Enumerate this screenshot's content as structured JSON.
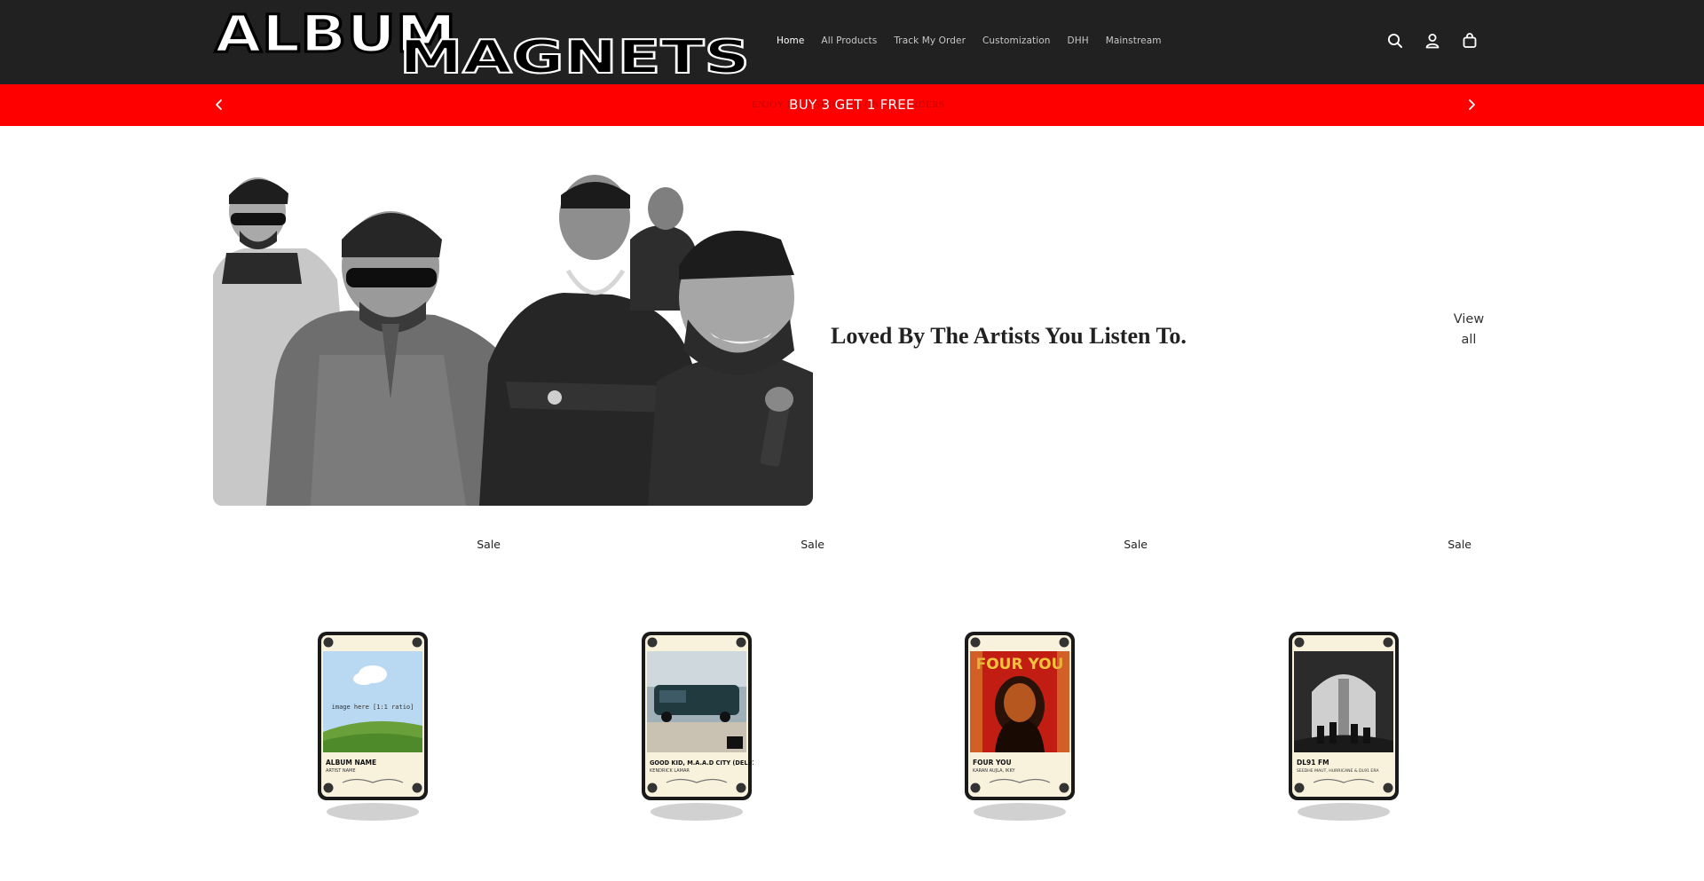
{
  "header": {
    "logo_text_top": "ALBUM",
    "logo_text_bottom": "MAGNETS",
    "nav": [
      {
        "label": "Home",
        "active": true
      },
      {
        "label": "All Products",
        "active": false
      },
      {
        "label": "Track My Order",
        "active": false
      },
      {
        "label": "Customization",
        "active": false
      },
      {
        "label": "DHH",
        "active": false
      },
      {
        "label": "Mainstream",
        "active": false
      }
    ],
    "icons": [
      "search-icon",
      "account-icon",
      "cart-icon"
    ]
  },
  "announcement": {
    "text": "BUY 3 GET 1 FREE",
    "ghost_text": "ENJOY FREE SHIPPING ON ALL ORDERS",
    "background": "#fe0000",
    "icons": [
      "chevron-left-icon",
      "chevron-right-icon"
    ]
  },
  "hero": {
    "title": "Loved By The Artists You Listen To.",
    "view_all_line1": "View",
    "view_all_line2": "all"
  },
  "products": [
    {
      "badge": "Sale",
      "card_title": "ALBUM NAME",
      "card_artist": "ARTIST NAME",
      "card_placeholder": "image here [1:1 ratio]"
    },
    {
      "badge": "Sale",
      "card_title": "GOOD KID, M.A.A.D CITY (DELUXE)",
      "card_artist": "KENDRICK LAMAR"
    },
    {
      "badge": "Sale",
      "card_title": "FOUR YOU",
      "card_artist": "KARAN AUJLA, IKKY",
      "art_text": "FOUR YOU"
    },
    {
      "badge": "Sale",
      "card_title": "DL91 FM",
      "card_artist": "SEEDHE MAUT, HURRICANE & DL91 ERA"
    }
  ],
  "colors": {
    "header_bg": "#212121",
    "announcement_bg": "#fe0000",
    "card_frame": "#1a1a1a",
    "card_paper": "#f8f1dc"
  }
}
